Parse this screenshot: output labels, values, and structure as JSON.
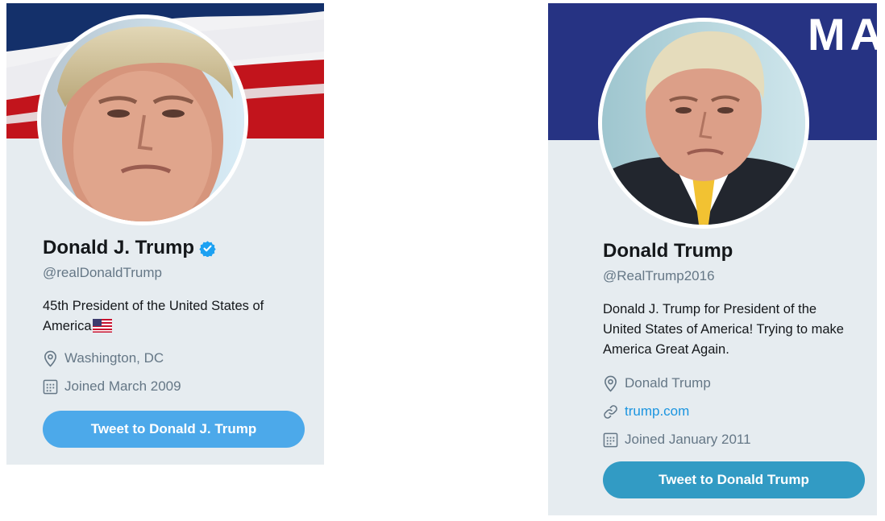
{
  "profiles": [
    {
      "name": "Donald J. Trump",
      "verified": true,
      "handle": "@realDonaldTrump",
      "bio": "45th President of the United States of America",
      "bio_emoji": "us-flag",
      "location": "Washington, DC",
      "joined": "Joined March 2009",
      "button_label": "Tweet to Donald J. Trump",
      "button_color": "#4ca9ea",
      "banner": "american-flag-banner"
    },
    {
      "name": "Donald Trump",
      "verified": false,
      "handle": "@RealTrump2016",
      "bio_line1": "Donald J. Trump for President of the",
      "bio_line2": "United States of America! Trying to make",
      "bio_line3": "America Great Again.",
      "location": "Donald Trump",
      "website": "trump.com",
      "joined": "Joined January 2011",
      "button_label": "Tweet to Donald Trump",
      "button_color": "#329bc4",
      "banner": "navy-banner",
      "banner_text": "MA"
    }
  ],
  "colors": {
    "card_bg": "#e6ecf0",
    "text_primary": "#14171a",
    "text_secondary": "#657786",
    "verified_blue": "#1da1f2",
    "link_blue": "#1b95e0",
    "banner_navy": "#263383"
  }
}
